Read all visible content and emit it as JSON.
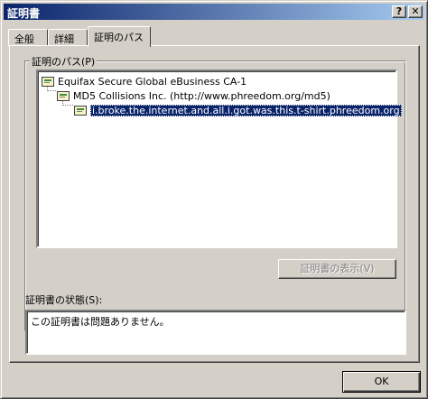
{
  "window": {
    "title": "証明書",
    "help_glyph": "?",
    "close_glyph": "✕"
  },
  "tabs": [
    {
      "label": "全般",
      "active": false
    },
    {
      "label": "詳細",
      "active": false
    },
    {
      "label": "証明のパス",
      "active": true
    }
  ],
  "cert_path": {
    "group_label": "証明のパス(P)",
    "items": [
      {
        "label": "Equifax Secure Global eBusiness CA-1",
        "icon": "certificate-icon"
      },
      {
        "label": "MD5 Collisions Inc. (http://www.phreedom.org/md5)",
        "icon": "certificate-icon"
      },
      {
        "label": "i.broke.the.internet.and.all.i.got.was.this.t-shirt.phreedom.org",
        "icon": "certificate-icon",
        "selected": true
      }
    ],
    "view_button": "証明書の表示(V)"
  },
  "status": {
    "label": "証明書の状態(S):",
    "text": "この証明書は問題ありません。"
  },
  "footer": {
    "ok_label": "OK"
  }
}
